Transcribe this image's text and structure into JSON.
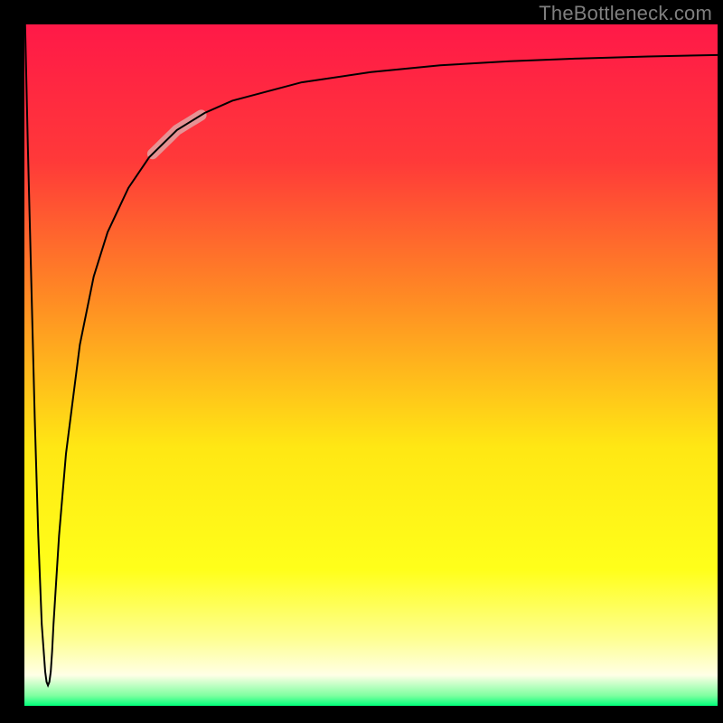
{
  "attribution": "TheBottleneck.com",
  "chart_data": {
    "type": "line",
    "title": "",
    "xlabel": "",
    "ylabel": "",
    "xlim": [
      0,
      100
    ],
    "ylim": [
      0,
      100
    ],
    "axes_visible": false,
    "background_gradient": {
      "direction": "vertical",
      "stops": [
        {
          "pos": 0.0,
          "color": "#ff1948"
        },
        {
          "pos": 0.2,
          "color": "#ff3939"
        },
        {
          "pos": 0.4,
          "color": "#ff8a24"
        },
        {
          "pos": 0.62,
          "color": "#ffe714"
        },
        {
          "pos": 0.8,
          "color": "#ffff1a"
        },
        {
          "pos": 0.9,
          "color": "#feff90"
        },
        {
          "pos": 0.955,
          "color": "#ffffe6"
        },
        {
          "pos": 0.985,
          "color": "#7fffa0"
        },
        {
          "pos": 1.0,
          "color": "#00ff7a"
        }
      ]
    },
    "series": [
      {
        "name": "curve",
        "stroke": "#000000",
        "stroke_width_px": 2,
        "x": [
          0.1,
          0.5,
          1.0,
          1.5,
          2.0,
          2.5,
          3.0,
          3.2,
          3.4,
          3.6,
          3.8,
          4.0,
          4.2,
          5.0,
          6.0,
          8.0,
          10.0,
          12.0,
          15.0,
          18.0,
          22.0,
          26.0,
          30.0,
          40.0,
          50.0,
          60.0,
          70.0,
          80.0,
          90.0,
          100.0
        ],
        "y": [
          100.0,
          82.0,
          62.0,
          42.0,
          25.0,
          12.0,
          5.0,
          3.5,
          3.0,
          3.5,
          5.0,
          8.0,
          12.0,
          25.0,
          37.0,
          53.0,
          63.0,
          69.5,
          76.0,
          80.5,
          84.5,
          87.0,
          88.8,
          91.5,
          93.0,
          94.0,
          94.6,
          95.0,
          95.3,
          95.5
        ]
      }
    ],
    "annotations": [
      {
        "name": "highlight-segment",
        "type": "overlay-stroke",
        "color": "#e2a3a3",
        "stroke_width_px": 12,
        "x_range": [
          18.5,
          25.5
        ],
        "y_range": [
          81.0,
          86.7
        ]
      }
    ]
  }
}
